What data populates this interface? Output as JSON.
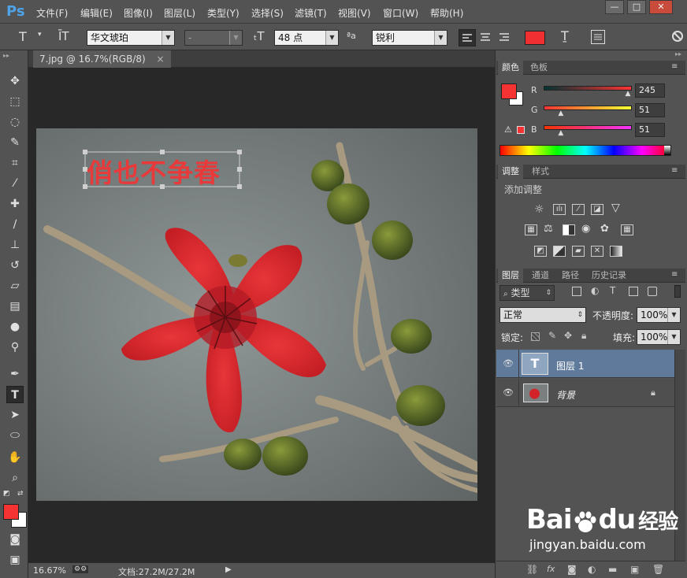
{
  "app": {
    "logo": "Ps"
  },
  "menu": [
    "文件(F)",
    "编辑(E)",
    "图像(I)",
    "图层(L)",
    "类型(Y)",
    "选择(S)",
    "滤镜(T)",
    "视图(V)",
    "窗口(W)",
    "帮助(H)"
  ],
  "window_buttons": {
    "minimize": "—",
    "restore": "□",
    "close": "✕"
  },
  "options": {
    "font_family": "华文琥珀",
    "font_style": "-",
    "font_size": "48 点",
    "aa_label": "ªa",
    "antialias": "锐利",
    "text_color": "#f03030"
  },
  "document": {
    "tab_title": "7.jpg @ 16.7%(RGB/8)",
    "tab_close": "×",
    "text_layer_text": "俏也不争春",
    "text_color": "#e83a3a"
  },
  "status": {
    "zoom": "16.67%",
    "doc_info": "文档:27.2M/27.2M"
  },
  "color_panel": {
    "tabs": [
      "颜色",
      "色板"
    ],
    "fg": "#f53333",
    "channels": [
      {
        "label": "R",
        "value": "245",
        "level": 0.96
      },
      {
        "label": "G",
        "value": "51",
        "level": 0.2
      },
      {
        "label": "B",
        "value": "51",
        "level": 0.2
      }
    ]
  },
  "adjust_panel": {
    "tabs": [
      "调整",
      "样式"
    ],
    "title": "添加调整"
  },
  "layers_panel": {
    "tabs": [
      "图层",
      "通道",
      "路径",
      "历史记录"
    ],
    "filter_kind": "类型",
    "blend_mode": "正常",
    "opacity_label": "不透明度:",
    "opacity": "100%",
    "lock_label": "锁定:",
    "fill_label": "填充:",
    "fill": "100%",
    "layers": [
      {
        "name": "图层 1",
        "type": "text",
        "selected": true
      },
      {
        "name": "背景",
        "type": "image",
        "locked": true
      }
    ]
  },
  "watermark": {
    "brand": "Bai",
    "brand_suffix": "du",
    "brand_cn": "经验",
    "url": "jingyan.baidu.com"
  }
}
